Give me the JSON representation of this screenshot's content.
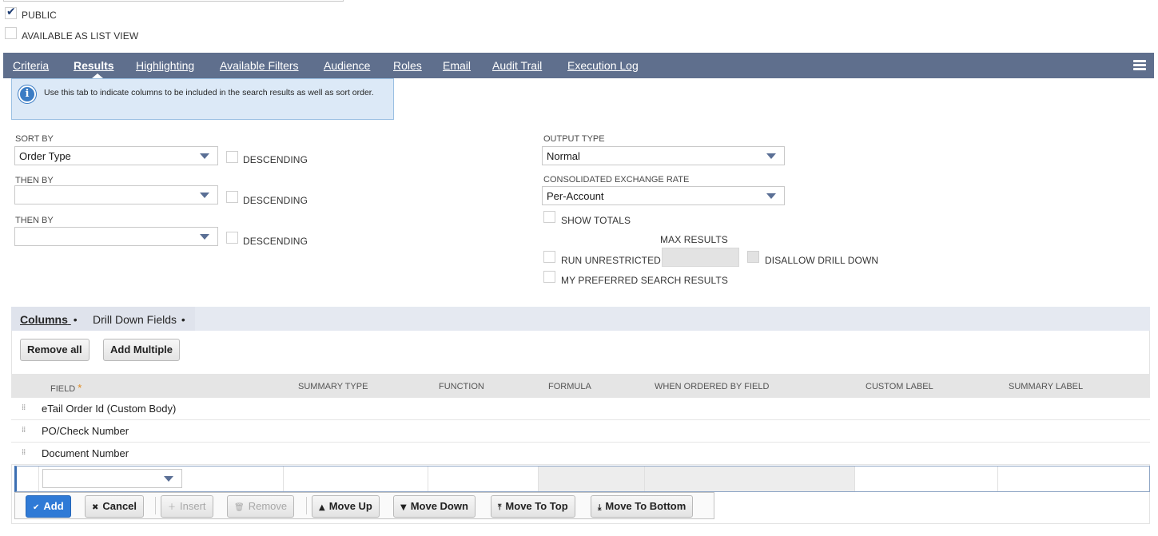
{
  "top": {
    "public_label": "PUBLIC",
    "public_checked": true,
    "list_view_label": "AVAILABLE AS LIST VIEW"
  },
  "tabs": [
    {
      "label": "Criteria"
    },
    {
      "label": "Results"
    },
    {
      "label": "Highlighting"
    },
    {
      "label": "Available Filters"
    },
    {
      "label": "Audience"
    },
    {
      "label": "Roles"
    },
    {
      "label": "Email"
    },
    {
      "label": "Audit Trail"
    },
    {
      "label": "Execution Log"
    }
  ],
  "info": {
    "text": "Use this tab to indicate columns to be included in the search results as well as sort order."
  },
  "sort": {
    "sort_by_label": "SORT BY",
    "sort_by_value": "Order Type",
    "then_by_label": "THEN BY",
    "then_by_1_value": "",
    "then_by_2_value": "",
    "descending_label": "DESCENDING"
  },
  "output": {
    "output_type_label": "OUTPUT TYPE",
    "output_type_value": "Normal",
    "exchange_rate_label": "CONSOLIDATED EXCHANGE RATE",
    "exchange_rate_value": "Per-Account",
    "show_totals_label": "SHOW TOTALS",
    "max_results_label": "MAX RESULTS",
    "run_unrestricted_label": "RUN UNRESTRICTED",
    "disallow_drill_label": "DISALLOW DRILL DOWN",
    "preferred_label": "MY PREFERRED SEARCH RESULTS"
  },
  "sublist": {
    "tab_columns": "Columns",
    "tab_drill": "Drill Down Fields",
    "dot": "•",
    "remove_all": "Remove all",
    "add_multiple": "Add Multiple",
    "headers": {
      "field": "FIELD",
      "required_mark": "*",
      "summary_type": "SUMMARY TYPE",
      "function": "FUNCTION",
      "formula": "FORMULA",
      "when_ordered": "WHEN ORDERED BY FIELD",
      "custom_label": "CUSTOM LABEL",
      "summary_label": "SUMMARY LABEL"
    },
    "rows": [
      {
        "field": "eTail Order Id (Custom Body)"
      },
      {
        "field": "PO/Check Number"
      },
      {
        "field": "Document Number"
      }
    ],
    "actions": {
      "add": "Add",
      "cancel": "Cancel",
      "insert": "Insert",
      "remove": "Remove",
      "move_up": "Move Up",
      "move_down": "Move Down",
      "move_top": "Move To Top",
      "move_bottom": "Move To Bottom"
    }
  },
  "colors": {
    "tabbar": "#5f6f8d",
    "primary_button": "#2f7ad6",
    "info_bg": "#dce9f7"
  }
}
